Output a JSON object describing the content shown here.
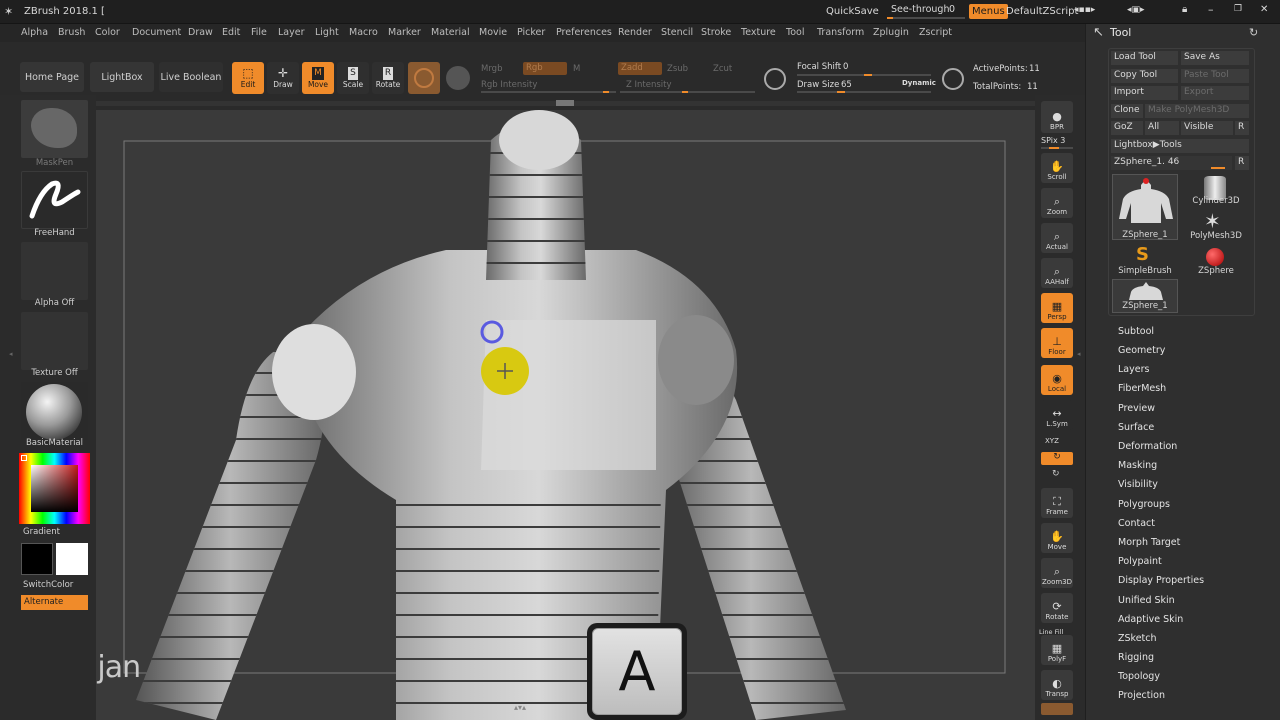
{
  "titlebar": {
    "app_title": "ZBrush 2018.1 [",
    "quicksave": "QuickSave",
    "seethrough": "See-through",
    "seethrough_value": "0",
    "menus": "Menus",
    "script": "DefaultZScript"
  },
  "menubar": [
    "Alpha",
    "Brush",
    "Color",
    "Document",
    "Draw",
    "Edit",
    "File",
    "Layer",
    "Light",
    "Macro",
    "Marker",
    "Material",
    "Movie",
    "Picker",
    "Preferences",
    "Render",
    "Stencil",
    "Stroke",
    "Texture",
    "Tool",
    "Transform",
    "Zplugin",
    "Zscript"
  ],
  "shelf": {
    "home_page": "Home Page",
    "lightbox": "LightBox",
    "live_boolean": "Live Boolean",
    "edit": "Edit",
    "draw": "Draw",
    "move": "Move",
    "scale": "Scale",
    "rotate": "Rotate",
    "mrgb": "Mrgb",
    "rgb": "Rgb",
    "m": "M",
    "rgb_intensity": "Rgb Intensity",
    "zadd": "Zadd",
    "zsub": "Zsub",
    "zcut": "Zcut",
    "z_intensity": "Z Intensity",
    "focal_shift_label": "Focal Shift",
    "focal_shift_value": "0",
    "draw_size_label": "Draw Size",
    "draw_size_value": "65",
    "dynamic": "Dynamic",
    "active_points_label": "ActivePoints:",
    "active_points_value": "11",
    "total_points_label": "TotalPoints:",
    "total_points_value": "11",
    "draw_size_fill": 0.3,
    "focal_shift_fill": 0.5
  },
  "lefttray": {
    "brush": "MaskPen",
    "stroke": "FreeHand",
    "alpha": "Alpha Off",
    "texture": "Texture Off",
    "material": "BasicMaterial",
    "gradient": "Gradient",
    "switchcolor": "SwitchColor",
    "alternate": "Alternate"
  },
  "navcol": {
    "bpr": "BPR",
    "spix": "SPix 3",
    "scroll": "Scroll",
    "zoom": "Zoom",
    "actual": "Actual",
    "aahalf": "AAHalf",
    "persp": "Persp",
    "floor": "Floor",
    "local": "Local",
    "lsym": "L.Sym",
    "xyz": "XYZ",
    "frame": "Frame",
    "move": "Move",
    "zoom3d": "Zoom3D",
    "rotate": "Rotate",
    "linefill": "Line Fill",
    "polyf": "PolyF",
    "transp": "Transp"
  },
  "toolpanel": {
    "title": "Tool",
    "load_tool": "Load Tool",
    "save_as": "Save As",
    "copy_tool": "Copy Tool",
    "paste_tool": "Paste Tool",
    "import": "Import",
    "export": "Export",
    "clone": "Clone",
    "make_polymesh": "Make PolyMesh3D",
    "goz": "GoZ",
    "all": "All",
    "visible": "Visible",
    "r": "R",
    "lightbox_tools": "Lightbox▶Tools",
    "current_tool": "ZSphere_1. 46",
    "thumbs": [
      "ZSphere_1",
      "Cylinder3D",
      "PolyMesh3D",
      "SimpleBrush",
      "ZSphere",
      "ZSphere_1"
    ],
    "sections": [
      "Subtool",
      "Geometry",
      "Layers",
      "FiberMesh",
      "Preview",
      "Surface",
      "Deformation",
      "Masking",
      "Visibility",
      "Polygroups",
      "Contact",
      "Morph Target",
      "Polypaint",
      "Display Properties",
      "Unified Skin",
      "Adaptive Skin",
      "ZSketch",
      "Rigging",
      "Topology",
      "Projection"
    ]
  },
  "overlay": {
    "watermark": "seljan",
    "key": "A"
  },
  "colors": {
    "accent": "#f08b2a",
    "panel": "#2f2f2f",
    "canvas": "#3a3a3a"
  }
}
